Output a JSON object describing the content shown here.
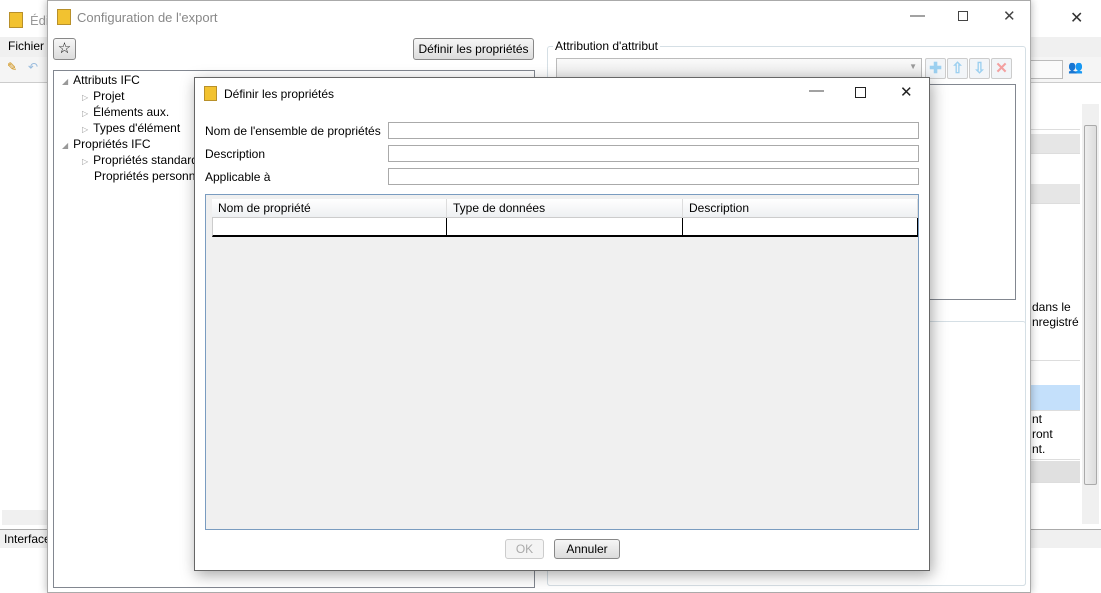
{
  "background_window": {
    "title": "Édi",
    "menu_file": "Fichier",
    "status": "Interface",
    "right_cells": [
      "dans le",
      "nregistré",
      "nt",
      "ront",
      "nt."
    ]
  },
  "config_window": {
    "title": "Configuration de l'export",
    "define_properties_button": "Définir les propriétés",
    "tree": [
      {
        "label": "Attributs IFC",
        "level": 0,
        "expanded": true
      },
      {
        "label": "Projet",
        "level": 1
      },
      {
        "label": "Éléments aux.",
        "level": 1
      },
      {
        "label": "Types d'élément",
        "level": 1
      },
      {
        "label": "Propriétés IFC",
        "level": 0,
        "expanded": true
      },
      {
        "label": "Propriétés standard",
        "level": 1
      },
      {
        "label": "Propriétés personnalisées",
        "level": 1
      }
    ],
    "attribution_group_label": "Attribution d'attribut"
  },
  "dialog": {
    "title": "Définir les propriétés",
    "fields": [
      {
        "label": "Nom de l'ensemble de propriétés",
        "value": ""
      },
      {
        "label": "Description",
        "value": ""
      },
      {
        "label": "Applicable à",
        "value": ""
      }
    ],
    "columns": [
      "Nom de propriété",
      "Type de données",
      "Description"
    ],
    "ok_label": "OK",
    "cancel_label": "Annuler"
  }
}
